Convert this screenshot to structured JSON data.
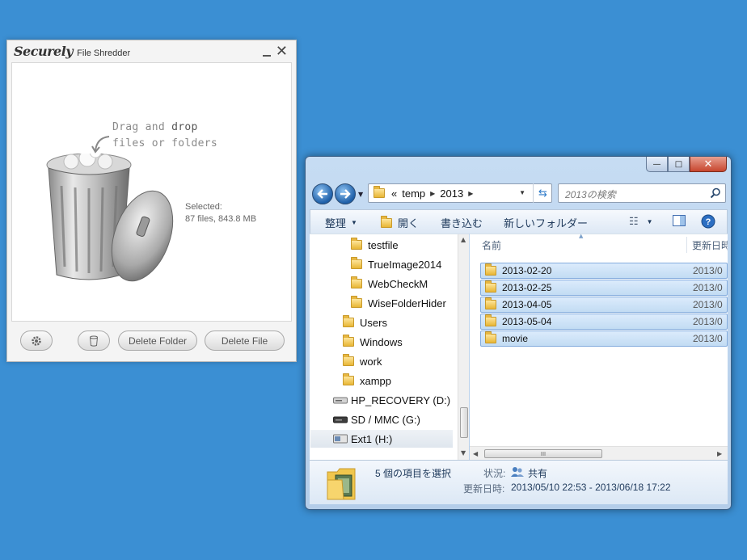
{
  "shredder": {
    "logo": "Securely",
    "subtitle": "File Shredder",
    "drag_line1_a": "Drag and ",
    "drag_line1_b": "drop",
    "drag_line2": "files or folders",
    "selected_label": "Selected:",
    "selected_value": "87 files, 843.8 MB",
    "delete_folder": "Delete Folder",
    "delete_file": "Delete File"
  },
  "explorer": {
    "caption": {
      "minimize": "—",
      "maximize": "□",
      "close": "✕"
    },
    "address": {
      "prefix": "«",
      "crumbs": [
        "temp",
        "2013"
      ]
    },
    "search_placeholder": "2013の検索",
    "toolbar": {
      "organize": "整理",
      "open": "開く",
      "burn": "書き込む",
      "new_folder": "新しいフォルダー"
    },
    "tree": [
      {
        "label": "testfile",
        "icon": "folder"
      },
      {
        "label": "TrueImage2014",
        "icon": "folder"
      },
      {
        "label": "WebCheckM",
        "icon": "folder"
      },
      {
        "label": "WiseFolderHider",
        "icon": "folder"
      },
      {
        "label": "Users",
        "icon": "folder"
      },
      {
        "label": "Windows",
        "icon": "folder"
      },
      {
        "label": "work",
        "icon": "folder"
      },
      {
        "label": "xampp",
        "icon": "folder"
      },
      {
        "label": "HP_RECOVERY (D:)",
        "icon": "drive"
      },
      {
        "label": "SD / MMC (G:)",
        "icon": "drive"
      },
      {
        "label": "Ext1 (H:)",
        "icon": "drive-external"
      }
    ],
    "columns": {
      "name": "名前",
      "modified": "更新日時"
    },
    "files": [
      {
        "name": "2013-02-20",
        "date": "2013/0"
      },
      {
        "name": "2013-02-25",
        "date": "2013/0"
      },
      {
        "name": "2013-04-05",
        "date": "2013/0"
      },
      {
        "name": "2013-05-04",
        "date": "2013/0"
      },
      {
        "name": "movie",
        "date": "2013/0"
      }
    ],
    "hscroll_grip": "III",
    "details": {
      "count": "5 個の項目を選択",
      "state_label": "状況:",
      "state_value": "共有",
      "modified_label": "更新日時:",
      "modified_value": "2013/05/10 22:53 - 2013/06/18 17:22"
    }
  }
}
